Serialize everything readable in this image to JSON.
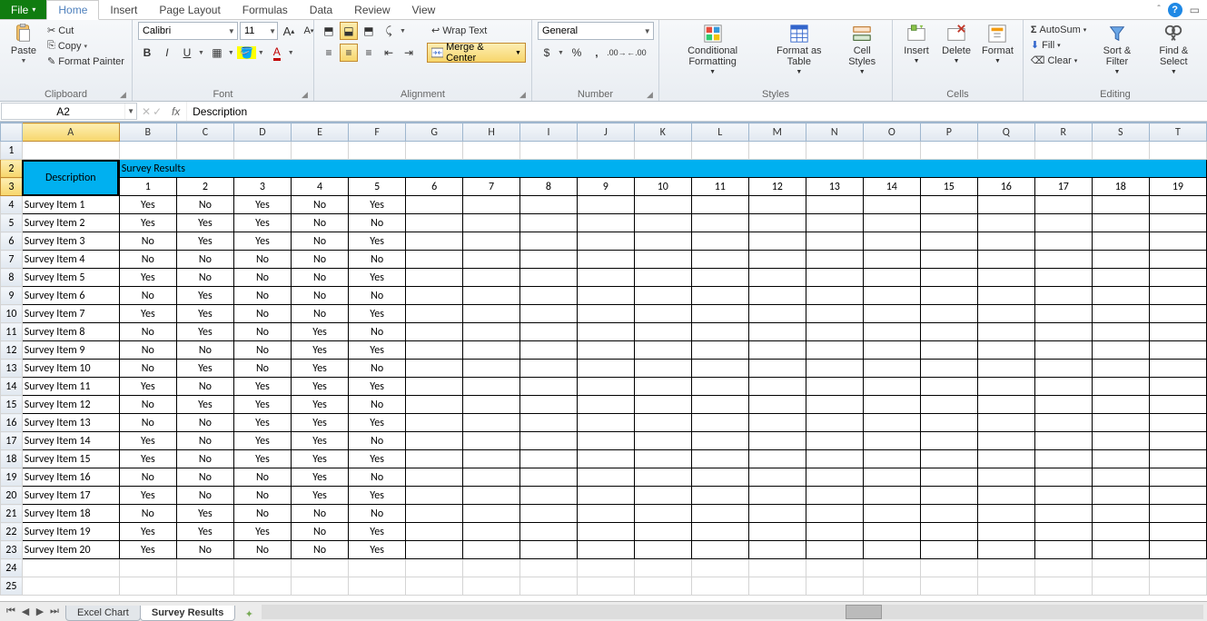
{
  "tabs": {
    "file": "File",
    "home": "Home",
    "insert": "Insert",
    "pageLayout": "Page Layout",
    "formulas": "Formulas",
    "data": "Data",
    "review": "Review",
    "view": "View"
  },
  "clipboard": {
    "paste": "Paste",
    "cut": "Cut",
    "copy": "Copy",
    "formatPainter": "Format Painter",
    "group": "Clipboard"
  },
  "font": {
    "name": "Calibri",
    "size": "11",
    "group": "Font"
  },
  "alignment": {
    "wrap": "Wrap Text",
    "merge": "Merge & Center",
    "group": "Alignment"
  },
  "number": {
    "format": "General",
    "group": "Number"
  },
  "styles": {
    "cond": "Conditional Formatting",
    "table": "Format as Table",
    "cell": "Cell Styles",
    "group": "Styles"
  },
  "cells": {
    "insert": "Insert",
    "delete": "Delete",
    "format": "Format",
    "group": "Cells"
  },
  "editing": {
    "sum": "AutoSum",
    "fill": "Fill",
    "clear": "Clear",
    "sort": "Sort & Filter",
    "find": "Find & Select",
    "group": "Editing"
  },
  "namebox": "A2",
  "formula": "Description",
  "columns": [
    "A",
    "B",
    "C",
    "D",
    "E",
    "F",
    "G",
    "H",
    "I",
    "J",
    "K",
    "L",
    "M",
    "N",
    "O",
    "P",
    "Q",
    "R",
    "S",
    "T"
  ],
  "header": {
    "desc": "Description",
    "survey": "Survey Results",
    "nums": [
      "1",
      "2",
      "3",
      "4",
      "5",
      "6",
      "7",
      "8",
      "9",
      "10",
      "11",
      "12",
      "13",
      "14",
      "15",
      "16",
      "17",
      "18",
      "19"
    ]
  },
  "rows": [
    {
      "n": "4",
      "label": "Survey Item 1",
      "v": [
        "Yes",
        "No",
        "Yes",
        "No",
        "Yes"
      ]
    },
    {
      "n": "5",
      "label": "Survey Item 2",
      "v": [
        "Yes",
        "Yes",
        "Yes",
        "No",
        "No"
      ]
    },
    {
      "n": "6",
      "label": "Survey Item 3",
      "v": [
        "No",
        "Yes",
        "Yes",
        "No",
        "Yes"
      ]
    },
    {
      "n": "7",
      "label": "Survey Item 4",
      "v": [
        "No",
        "No",
        "No",
        "No",
        "No"
      ]
    },
    {
      "n": "8",
      "label": "Survey Item 5",
      "v": [
        "Yes",
        "No",
        "No",
        "No",
        "Yes"
      ]
    },
    {
      "n": "9",
      "label": "Survey Item 6",
      "v": [
        "No",
        "Yes",
        "No",
        "No",
        "No"
      ]
    },
    {
      "n": "10",
      "label": "Survey Item 7",
      "v": [
        "Yes",
        "Yes",
        "No",
        "No",
        "Yes"
      ]
    },
    {
      "n": "11",
      "label": "Survey Item 8",
      "v": [
        "No",
        "Yes",
        "No",
        "Yes",
        "No"
      ]
    },
    {
      "n": "12",
      "label": "Survey Item 9",
      "v": [
        "No",
        "No",
        "No",
        "Yes",
        "Yes"
      ]
    },
    {
      "n": "13",
      "label": "Survey Item 10",
      "v": [
        "No",
        "Yes",
        "No",
        "Yes",
        "No"
      ]
    },
    {
      "n": "14",
      "label": "Survey Item 11",
      "v": [
        "Yes",
        "No",
        "Yes",
        "Yes",
        "Yes"
      ]
    },
    {
      "n": "15",
      "label": "Survey Item 12",
      "v": [
        "No",
        "Yes",
        "Yes",
        "Yes",
        "No"
      ]
    },
    {
      "n": "16",
      "label": "Survey Item 13",
      "v": [
        "No",
        "No",
        "Yes",
        "Yes",
        "Yes"
      ]
    },
    {
      "n": "17",
      "label": "Survey Item 14",
      "v": [
        "Yes",
        "No",
        "Yes",
        "Yes",
        "No"
      ]
    },
    {
      "n": "18",
      "label": "Survey Item 15",
      "v": [
        "Yes",
        "No",
        "Yes",
        "Yes",
        "Yes"
      ]
    },
    {
      "n": "19",
      "label": "Survey Item 16",
      "v": [
        "No",
        "No",
        "No",
        "Yes",
        "No"
      ]
    },
    {
      "n": "20",
      "label": "Survey Item 17",
      "v": [
        "Yes",
        "No",
        "No",
        "Yes",
        "Yes"
      ]
    },
    {
      "n": "21",
      "label": "Survey Item 18",
      "v": [
        "No",
        "Yes",
        "No",
        "No",
        "No"
      ]
    },
    {
      "n": "22",
      "label": "Survey Item 19",
      "v": [
        "Yes",
        "Yes",
        "Yes",
        "No",
        "Yes"
      ]
    },
    {
      "n": "23",
      "label": "Survey Item 20",
      "v": [
        "Yes",
        "No",
        "No",
        "No",
        "Yes"
      ]
    }
  ],
  "emptyRows": [
    "24",
    "25"
  ],
  "sheets": {
    "s1": "Excel Chart",
    "s2": "Survey Results"
  }
}
